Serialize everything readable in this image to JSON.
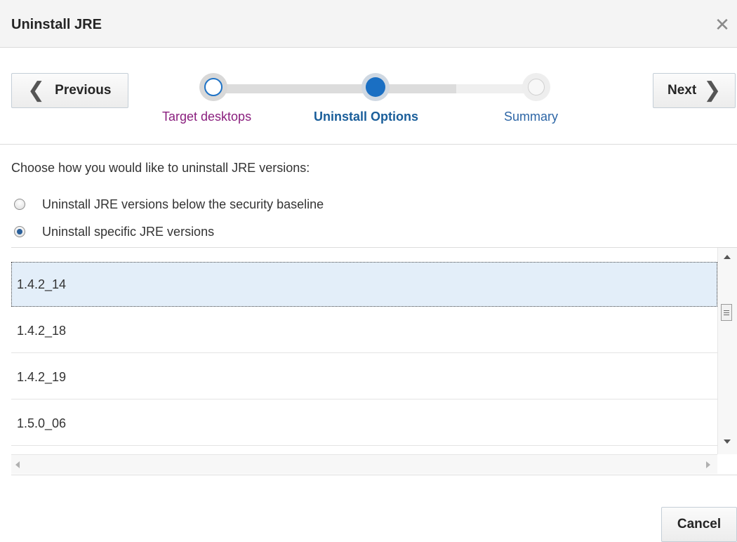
{
  "dialog": {
    "title": "Uninstall JRE",
    "close_glyph": "✕"
  },
  "train": {
    "previous_label": "Previous",
    "next_label": "Next",
    "steps": [
      {
        "label": "Target desktops",
        "state": "visited"
      },
      {
        "label": "Uninstall Options",
        "state": "current"
      },
      {
        "label": "Summary",
        "state": "unvisited"
      }
    ]
  },
  "options": {
    "prompt": "Choose how you would like to uninstall JRE versions:",
    "choices": [
      {
        "label": "Uninstall JRE versions below the security baseline",
        "checked": false
      },
      {
        "label": "Uninstall specific JRE versions",
        "checked": true
      }
    ]
  },
  "versions": {
    "items": [
      {
        "label": "1.4.2_14",
        "selected": true
      },
      {
        "label": "1.4.2_18",
        "selected": false
      },
      {
        "label": "1.4.2_19",
        "selected": false
      },
      {
        "label": "1.5.0_06",
        "selected": false
      }
    ]
  },
  "footer": {
    "cancel_label": "Cancel"
  },
  "icons": {
    "close": "close-icon",
    "previous": "chevron-left-icon",
    "next": "chevron-right-icon"
  },
  "colors": {
    "accent": "#1a6fc3",
    "visited_step": "#8a1f7e",
    "selected_row": "#e3eef9"
  }
}
